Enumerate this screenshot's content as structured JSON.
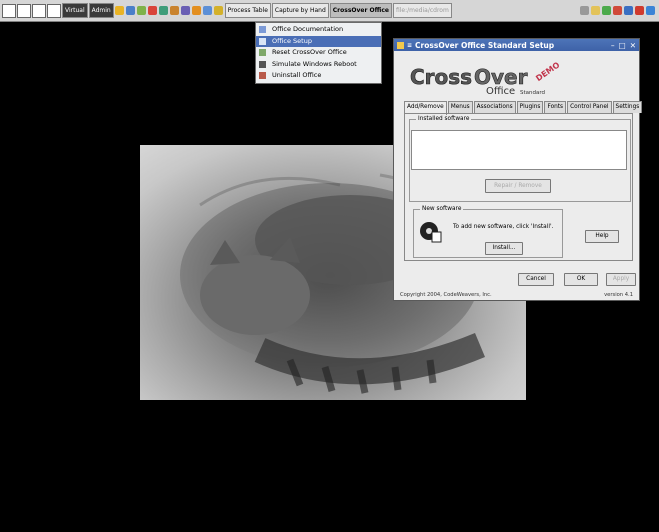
{
  "taskbar": {
    "buttons": [
      {
        "label": "Virtual"
      },
      {
        "label": "Admin"
      },
      {
        "label": "Process Table"
      },
      {
        "label": "Capture by Hand"
      },
      {
        "label": "CrossOver Office"
      },
      {
        "label": "file:/media/cdrom"
      }
    ]
  },
  "menu": {
    "items": [
      {
        "label": "Office Documentation"
      },
      {
        "label": "Office Setup"
      },
      {
        "label": "Reset CrossOver Office"
      },
      {
        "label": "Simulate Windows Reboot"
      },
      {
        "label": "Uninstall Office"
      }
    ]
  },
  "dialog": {
    "title": "CrossOver Office Standard Setup",
    "logo": {
      "word1": "Cross",
      "word2": "Over",
      "word3": "Office",
      "edition": "Standard",
      "badge": "DEMO"
    },
    "tabs": [
      "Add/Remove",
      "Menus",
      "Associations",
      "Plugins",
      "Fonts",
      "Control Panel",
      "Settings"
    ],
    "installed_label": "Installed software",
    "repair_label": "Repair / Remove",
    "new_label": "New software",
    "new_msg": "To add new software, click 'Install'.",
    "install_label": "Install...",
    "help_label": "Help",
    "cancel_label": "Cancel",
    "ok_label": "OK",
    "apply_label": "Apply",
    "copyright": "Copyright 2004, CodeWeavers, Inc.",
    "version": "version 4.1"
  }
}
